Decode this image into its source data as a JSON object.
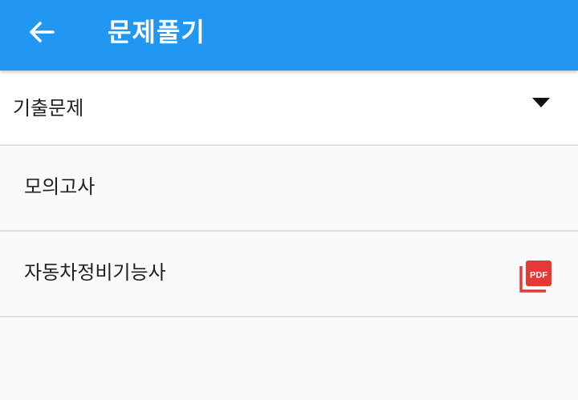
{
  "app_bar": {
    "title": "문제풀기",
    "back_icon": "arrow-left-icon",
    "background_color": "#2196f3"
  },
  "dropdown": {
    "selected": "기출문제",
    "arrow_icon": "dropdown-arrow-icon"
  },
  "list": {
    "items": [
      {
        "label": "모의고사",
        "icon": null
      },
      {
        "label": "자동차정비기능사",
        "icon": "pdf-icon",
        "icon_text": "PDF",
        "icon_color": "#e53935"
      }
    ]
  }
}
